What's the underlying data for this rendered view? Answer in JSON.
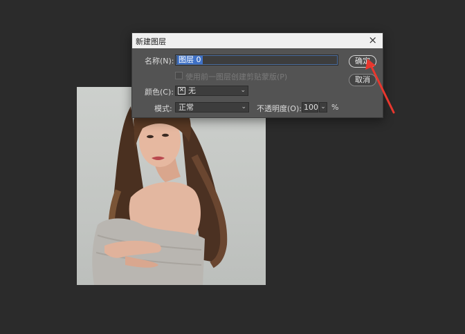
{
  "dialog": {
    "title": "新建图层",
    "close_glyph": "×",
    "name_label": "名称(N):",
    "name_value": "图层 0",
    "clip_checkbox_label": "使用前一图层创建剪贴蒙版(P)",
    "color_label": "颜色(C):",
    "color_icon": "x-icon",
    "color_value": "无",
    "mode_label": "模式:",
    "mode_value": "正常",
    "opacity_label": "不透明度(O):",
    "opacity_value": "100",
    "opacity_unit": "%",
    "ok_button": "确定",
    "cancel_button": "取消",
    "dropdown_glyph": "⌄"
  },
  "annotation": {
    "arrow_color": "#e8372e"
  },
  "colors": {
    "app_background": "#2b2b2b",
    "dialog_background": "#535353",
    "selection": "#3f71c6"
  }
}
